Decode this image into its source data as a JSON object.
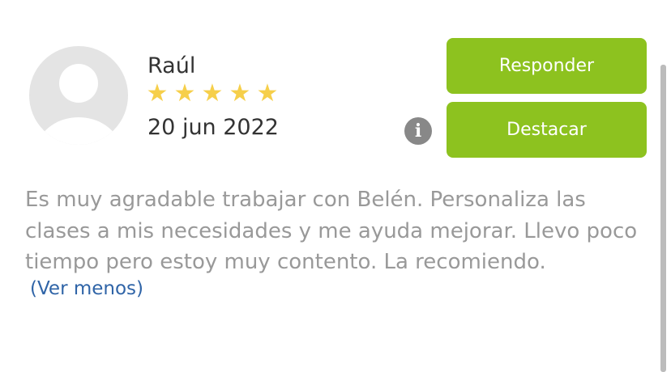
{
  "review": {
    "author": "Raúl",
    "rating": 5,
    "rating_max": 5,
    "stars": [
      "★",
      "★",
      "★",
      "★",
      "★"
    ],
    "date": "20 jun 2022",
    "text": "Es muy agradable trabajar con Belén. Personaliza las clases a mis necesidades y me ayuda mejorar. Llevo poco tiempo pero estoy muy contento. La recomiendo.",
    "see_less_label": "(Ver menos)"
  },
  "actions": {
    "respond_label": "Responder",
    "feature_label": "Destacar",
    "info_icon": "i"
  },
  "colors": {
    "button_green": "#8dc21f",
    "star_yellow": "#f6cf4a",
    "link_blue": "#2f64a7",
    "text_gray": "#999999"
  }
}
